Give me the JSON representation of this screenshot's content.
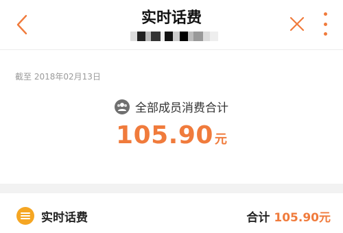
{
  "header": {
    "title": "实时话费",
    "phone_masked": "1■■■■■■■■■■",
    "back_icon": "chevron-left-icon",
    "close_icon": "close-icon",
    "more_icon": "more-vertical-icon"
  },
  "summary": {
    "date_text": "截至 2018年02月13日",
    "members_label": "全部成员消费合计",
    "members_icon": "group-icon",
    "amount": "105.90",
    "amount_unit": "元"
  },
  "bill_row": {
    "icon": "list-icon",
    "title": "实时话费",
    "total_label": "合计",
    "total_amount": "105.90元"
  },
  "colors": {
    "accent": "#f07b3c",
    "icon_yellow": "#f5a623",
    "muted": "#9a9a9a",
    "band": "#f2f2f2"
  }
}
